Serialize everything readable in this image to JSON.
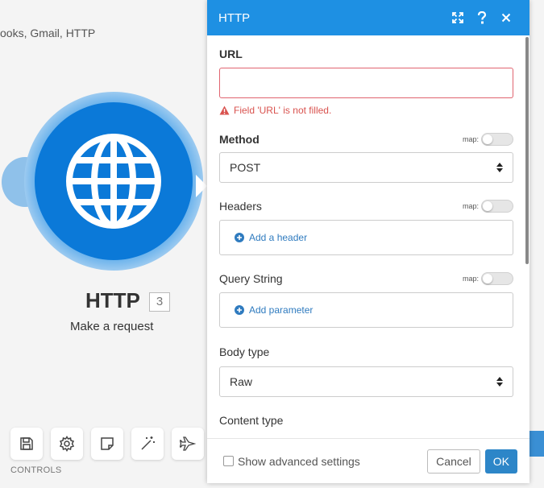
{
  "breadcrumb": "ooks, Gmail, HTTP",
  "module": {
    "title": "HTTP",
    "badge": "3",
    "subtitle": "Make a request",
    "icon": "globe-icon"
  },
  "controls": {
    "label": "CONTROLS",
    "buttons": [
      {
        "name": "save",
        "icon": "save-icon"
      },
      {
        "name": "settings",
        "icon": "gear-icon"
      },
      {
        "name": "notes",
        "icon": "note-icon"
      },
      {
        "name": "auto-align",
        "icon": "magic-wand-icon"
      },
      {
        "name": "explain-flow",
        "icon": "airplane-icon"
      }
    ]
  },
  "dialog": {
    "title": "HTTP",
    "header_icons": [
      "expand-icon",
      "help-icon",
      "close-icon"
    ],
    "url": {
      "label": "URL",
      "value": "",
      "error": "Field 'URL' is not filled."
    },
    "method": {
      "label": "Method",
      "map_label": "map:",
      "value": "POST"
    },
    "headers": {
      "label": "Headers",
      "map_label": "map:",
      "add_label": "Add a header"
    },
    "query_string": {
      "label": "Query String",
      "map_label": "map:",
      "add_label": "Add parameter"
    },
    "body_type": {
      "label": "Body type",
      "value": "Raw"
    },
    "content_type": {
      "label": "Content type"
    },
    "footer": {
      "advanced_label": "Show advanced settings",
      "advanced_checked": false,
      "cancel_label": "Cancel",
      "ok_label": "OK"
    }
  },
  "colors": {
    "header_blue": "#1e90e3",
    "module_blue": "#0b79d8",
    "error_red": "#d9534f",
    "link_blue": "#2f7bbf",
    "ok_blue": "#2d86c8"
  }
}
